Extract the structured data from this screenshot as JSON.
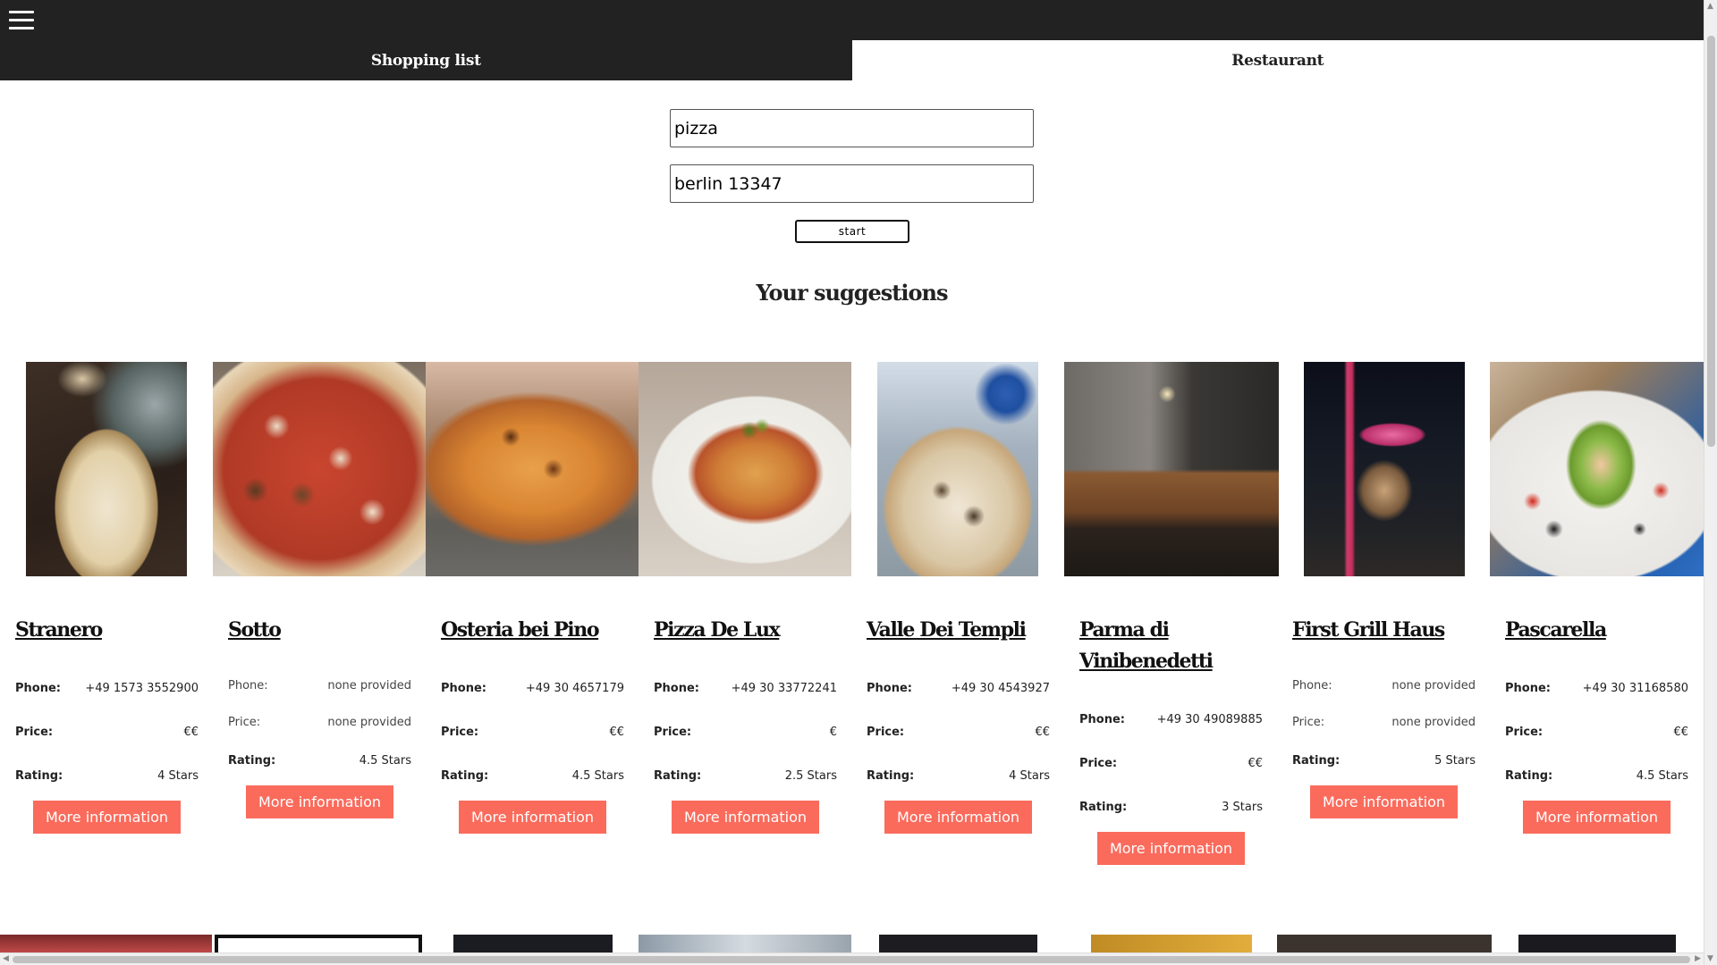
{
  "menu": {
    "icon": "hamburger-menu-icon"
  },
  "tabs": [
    {
      "label": "Shopping list",
      "active": false
    },
    {
      "label": "Restaurant",
      "active": true
    }
  ],
  "search": {
    "query_value": "pizza",
    "location_value": "berlin 13347",
    "start_label": "start"
  },
  "suggestions_title": "Your suggestions",
  "labels": {
    "phone": "Phone:",
    "price": "Price:",
    "rating": "Rating:",
    "more": "More information"
  },
  "restaurants": [
    {
      "name": "Stranero",
      "phone": "+49 1573 3552900",
      "price": "€€",
      "rating": "4 Stars",
      "photo": "pizza photo"
    },
    {
      "name": "Sotto",
      "phone": "none provided",
      "price": "none provided",
      "rating": "4.5 Stars",
      "photo": "pizza photo"
    },
    {
      "name": "Osteria bei Pino",
      "phone": "+49 30 4657179",
      "price": "€€",
      "rating": "4.5 Stars",
      "photo": "baked dish photo"
    },
    {
      "name": "Pizza De Lux",
      "phone": "+49 30 33772241",
      "price": "€",
      "rating": "2.5 Stars",
      "photo": "spaghetti photo"
    },
    {
      "name": "Valle Dei Templi",
      "phone": "+49 30 4543927",
      "price": "€€",
      "rating": "4 Stars",
      "photo": "pizza photo"
    },
    {
      "name": "Parma di Vinibenedetti",
      "phone": "+49 30 49089885",
      "price": "€€",
      "rating": "3 Stars",
      "photo": "restaurant interior photo"
    },
    {
      "name": "First Grill Haus",
      "phone": "none provided",
      "price": "none provided",
      "rating": "5 Stars",
      "photo": "storefront at night photo"
    },
    {
      "name": "Pascarella",
      "phone": "+49 30 31168580",
      "price": "€€",
      "rating": "4.5 Stars",
      "photo": "plated dish photo"
    }
  ],
  "colors": {
    "header": "#222222",
    "accent_button": "#fa6b5c",
    "background": "#ffffff"
  }
}
